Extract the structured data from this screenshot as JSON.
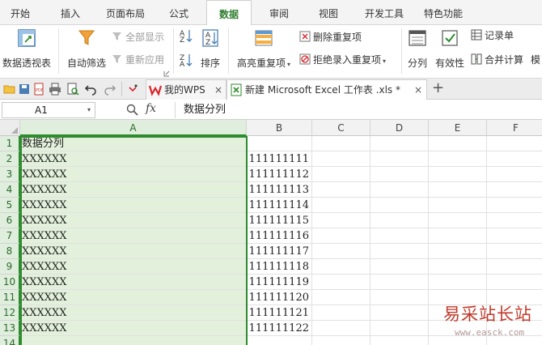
{
  "menu_tabs": [
    "开始",
    "插入",
    "页面布局",
    "公式",
    "数据",
    "审阅",
    "视图",
    "开发工具",
    "特色功能"
  ],
  "active_tab": "数据",
  "ribbon": {
    "pivot_table": "数据透视表",
    "auto_filter": "自动筛选",
    "show_all": "全部显示",
    "reapply": "重新应用",
    "sort": "排序",
    "highlight_duplicates": "高亮重复项",
    "delete_duplicates": "删除重复项",
    "reject_duplicates": "拒绝录入重复项",
    "split": "分列",
    "validity": "有效性",
    "record": "记录单",
    "consolidate": "合并计算",
    "more": "模"
  },
  "doc_tabs": {
    "my_wps": "我的WPS",
    "workbook": "新建 Microsoft Excel 工作表 .xls *",
    "close_glyph": "×",
    "new_tab_glyph": "+"
  },
  "formula_bar": {
    "name_box": "A1",
    "fx": "fx",
    "value": "数据分列"
  },
  "columns": [
    "A",
    "B",
    "C",
    "D",
    "E",
    "F"
  ],
  "rows": [
    "1",
    "2",
    "3",
    "4",
    "5",
    "6",
    "7",
    "8",
    "9",
    "10",
    "11",
    "12",
    "13",
    "14"
  ],
  "cells_a": [
    "数据分列",
    "XXXXXX",
    "XXXXXX",
    "XXXXXX",
    "XXXXXX",
    "XXXXXX",
    "XXXXXX",
    "XXXXXX",
    "XXXXXX",
    "XXXXXX",
    "XXXXXX",
    "XXXXXX",
    "XXXXXX",
    ""
  ],
  "cells_b": [
    "",
    "111111111",
    "111111112",
    "111111113",
    "111111114",
    "111111115",
    "111111116",
    "111111117",
    "111111118",
    "111111119",
    "111111120",
    "111111121",
    "111111122",
    ""
  ],
  "watermark": {
    "cn": "易采站长站",
    "url": "www.easck.com"
  },
  "colors": {
    "accent_green": "#2e8b2e",
    "selection_fill": "#e3f1dc",
    "wps_red": "#d9262c"
  }
}
